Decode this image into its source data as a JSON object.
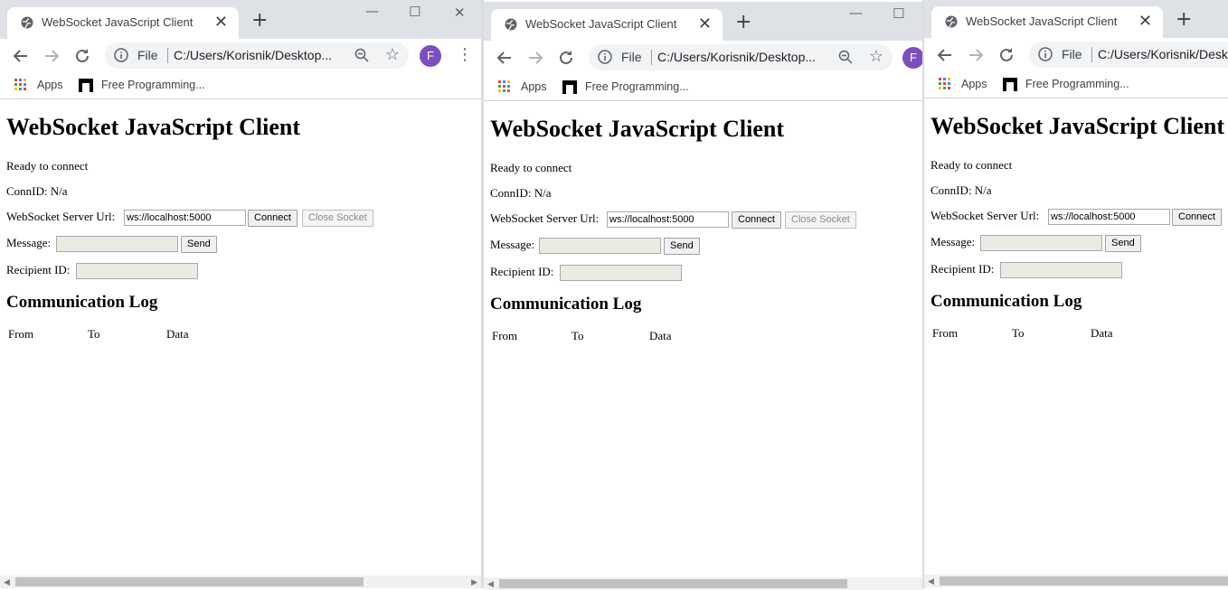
{
  "browser": {
    "tab_title": "WebSocket JavaScript Client",
    "tab_close": "✕",
    "new_tab": "+",
    "omnibox_scheme": "File",
    "omnibox_url_w1": "C:/Users/Korisnik/Desktop...",
    "omnibox_url_w2": "C:/Users/Korisnik/Desktop...",
    "omnibox_url_w3": "C:/Users/Korisnik/Deskt",
    "profile_initial": "F",
    "bookmarks": [
      {
        "label": "Apps",
        "icon": "apps-grid-icon"
      },
      {
        "label": "Free Programming...",
        "icon": "bookmark-favicon"
      }
    ],
    "window_controls": {
      "minimize": "—",
      "maximize": "☐",
      "close": "✕"
    }
  },
  "client": {
    "heading": "WebSocket JavaScript Client",
    "status": "Ready to connect",
    "conn_label": "ConnID: N/a",
    "server_url_label": "WebSocket Server Url:",
    "server_url_value": "ws://localhost:5000",
    "connect_button": "Connect",
    "close_button": "Close Socket",
    "message_label": "Message:",
    "message_value": "",
    "send_button": "Send",
    "recipient_label": "Recipient ID:",
    "recipient_value": "",
    "log_heading": "Communication Log",
    "log_columns": [
      "From",
      "To",
      "Data"
    ]
  },
  "colors": {
    "titlebar": "#dee1e6",
    "avatar": "#7b4fbf",
    "disabled_input": "#ebebe4"
  }
}
